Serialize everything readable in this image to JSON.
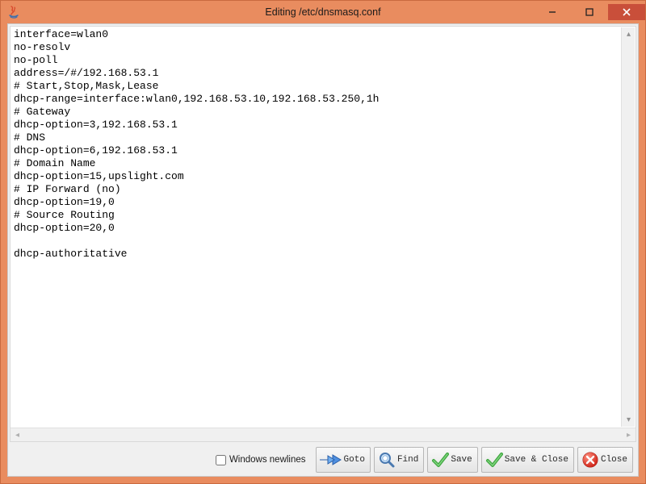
{
  "window": {
    "title": "Editing /etc/dnsmasq.conf"
  },
  "editor": {
    "content": "interface=wlan0\nno-resolv\nno-poll\naddress=/#/192.168.53.1\n# Start,Stop,Mask,Lease\ndhcp-range=interface:wlan0,192.168.53.10,192.168.53.250,1h\n# Gateway\ndhcp-option=3,192.168.53.1\n# DNS\ndhcp-option=6,192.168.53.1\n# Domain Name\ndhcp-option=15,upslight.com\n# IP Forward (no)\ndhcp-option=19,0\n# Source Routing\ndhcp-option=20,0\n\ndhcp-authoritative\n"
  },
  "toolbar": {
    "windows_newlines_label": "Windows newlines",
    "windows_newlines_checked": false,
    "goto_label": "Goto",
    "find_label": "Find",
    "save_label": "Save",
    "save_close_label": "Save & Close",
    "close_label": "Close"
  }
}
